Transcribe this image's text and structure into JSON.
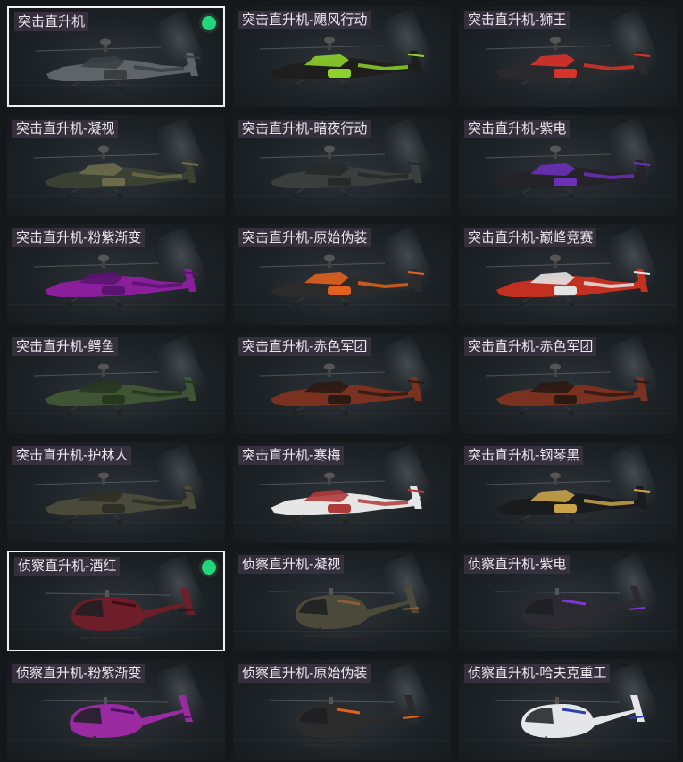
{
  "skins": [
    {
      "label": "突击直升机",
      "type": "attack",
      "body": "#5f6468",
      "accent": "#3b3f42",
      "equipped": true,
      "selected": true
    },
    {
      "label": "突击直升机-飓风行动",
      "type": "attack",
      "body": "#1e1f1d",
      "accent": "#8ed12a",
      "equipped": false,
      "selected": false
    },
    {
      "label": "突击直升机-狮王",
      "type": "attack",
      "body": "#2a2a2c",
      "accent": "#d8322a",
      "equipped": false,
      "selected": false
    },
    {
      "label": "突击直升机-凝视",
      "type": "attack",
      "body": "#3a4032",
      "accent": "#6b6a4a",
      "equipped": false,
      "selected": false
    },
    {
      "label": "突击直升机-暗夜行动",
      "type": "attack",
      "body": "#3a3f3d",
      "accent": "#262a29",
      "equipped": false,
      "selected": false
    },
    {
      "label": "突击直升机-紫电",
      "type": "attack",
      "body": "#242428",
      "accent": "#6b2fb8",
      "equipped": false,
      "selected": false
    },
    {
      "label": "突击直升机-粉紫渐变",
      "type": "attack",
      "body": "#8a1f9c",
      "accent": "#5a1470",
      "equipped": false,
      "selected": false
    },
    {
      "label": "突击直升机-原始伪装",
      "type": "attack",
      "body": "#2b2b2b",
      "accent": "#e0621e",
      "equipped": false,
      "selected": false
    },
    {
      "label": "突击直升机-巅峰竞赛",
      "type": "attack",
      "body": "#c4301f",
      "accent": "#e4e4e4",
      "equipped": false,
      "selected": false
    },
    {
      "label": "突击直升机-鳄鱼",
      "type": "attack",
      "body": "#3e5434",
      "accent": "#27361f",
      "equipped": false,
      "selected": false
    },
    {
      "label": "突击直升机-赤色军团",
      "type": "attack",
      "body": "#7a3120",
      "accent": "#2a1a14",
      "equipped": false,
      "selected": false
    },
    {
      "label": "突击直升机-赤色军团",
      "type": "attack",
      "body": "#7a3120",
      "accent": "#2a1a14",
      "equipped": false,
      "selected": false
    },
    {
      "label": "突击直升机-护林人",
      "type": "attack",
      "body": "#4a4a3a",
      "accent": "#2d2e24",
      "equipped": false,
      "selected": false
    },
    {
      "label": "突击直升机-寒梅",
      "type": "attack",
      "body": "#e6e6e6",
      "accent": "#b03a3a",
      "equipped": false,
      "selected": false
    },
    {
      "label": "突击直升机-钢琴黑",
      "type": "attack",
      "body": "#1a1b1d",
      "accent": "#c9a34a",
      "equipped": false,
      "selected": false
    },
    {
      "label": "侦察直升机-酒红",
      "type": "scout",
      "body": "#6e1e28",
      "accent": "#3a0f15",
      "equipped": true,
      "selected": true
    },
    {
      "label": "侦察直升机-凝视",
      "type": "scout",
      "body": "#4b4a3a",
      "accent": "#8a5e3a",
      "equipped": false,
      "selected": false
    },
    {
      "label": "侦察直升机-紫电",
      "type": "scout",
      "body": "#2a2a30",
      "accent": "#7a3ad0",
      "equipped": false,
      "selected": false
    },
    {
      "label": "侦察直升机-粉紫渐变",
      "type": "scout",
      "body": "#9a2aa0",
      "accent": "#4a1260",
      "equipped": false,
      "selected": false
    },
    {
      "label": "侦察直升机-原始伪装",
      "type": "scout",
      "body": "#2b2b2b",
      "accent": "#e0621e",
      "equipped": false,
      "selected": false
    },
    {
      "label": "侦察直升机-哈夫克重工",
      "type": "scout",
      "body": "#e4e6ea",
      "accent": "#2c3fa8",
      "equipped": false,
      "selected": false
    }
  ]
}
